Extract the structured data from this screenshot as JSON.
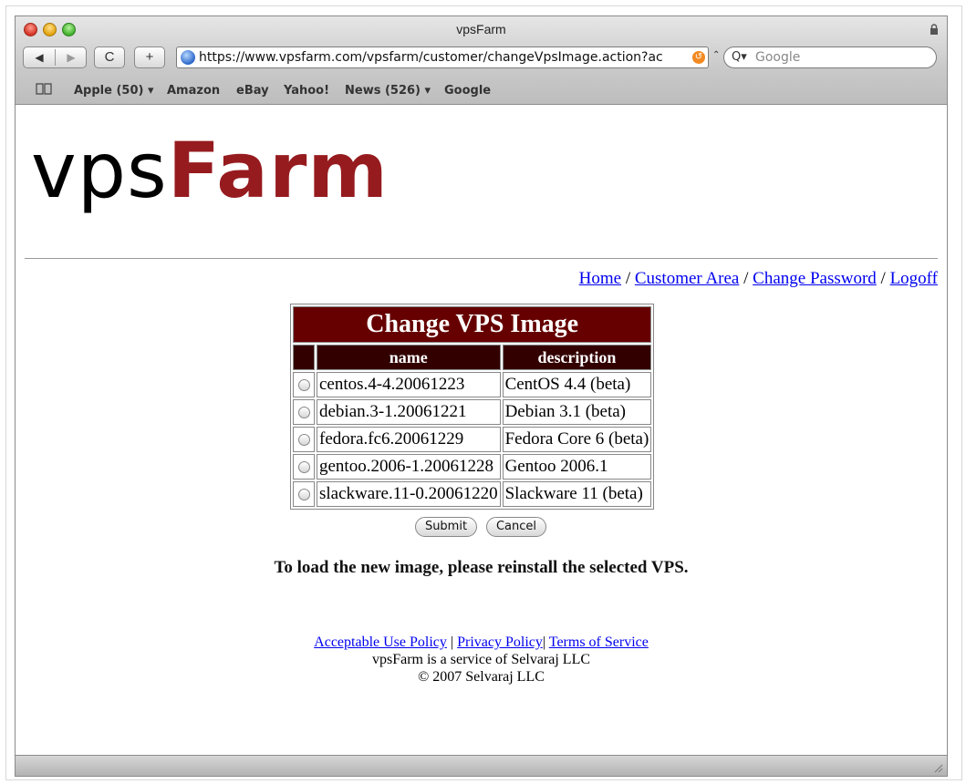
{
  "window": {
    "title": "vpsFarm"
  },
  "toolbar": {
    "back_glyph": "◀",
    "forward_glyph": "▶",
    "reload_glyph": "C",
    "add_glyph": "+",
    "url": "https://www.vpsfarm.com/vpsfarm/customer/changeVpsImage.action?ac",
    "search_placeholder": "Google"
  },
  "bookmarks": [
    "Apple (50) ▾",
    "Amazon",
    "eBay",
    "Yahoo!",
    "News (526) ▾",
    "Google"
  ],
  "logo": {
    "part1": "vps",
    "part2": "Farm"
  },
  "nav": {
    "home": "Home",
    "customer_area": "Customer Area",
    "change_password": "Change Password",
    "logoff": "Logoff",
    "sep": " / "
  },
  "table": {
    "caption": "Change VPS Image",
    "columns": [
      "name",
      "description"
    ],
    "rows": [
      {
        "name": "centos.4-4.20061223",
        "description": "CentOS 4.4 (beta)"
      },
      {
        "name": "debian.3-1.20061221",
        "description": "Debian 3.1 (beta)"
      },
      {
        "name": "fedora.fc6.20061229",
        "description": "Fedora Core 6 (beta)"
      },
      {
        "name": "gentoo.2006-1.20061228",
        "description": "Gentoo 2006.1"
      },
      {
        "name": "slackware.11-0.20061220",
        "description": "Slackware 11 (beta)"
      }
    ]
  },
  "form": {
    "submit": "Submit",
    "cancel": "Cancel"
  },
  "notice": "To load the new image, please reinstall the selected VPS.",
  "footer": {
    "aup": "Acceptable Use Policy",
    "privacy": "Privacy Policy",
    "tos": "Terms of Service",
    "sep1": " | ",
    "sep2": "| ",
    "service_line": "vpsFarm is a service of Selvaraj LLC",
    "copyright": "© 2007 Selvaraj LLC"
  },
  "colors": {
    "brand_red": "#961b1f",
    "table_caption_bg": "#660000",
    "table_header_bg": "#330000",
    "link": "#0000ee"
  }
}
